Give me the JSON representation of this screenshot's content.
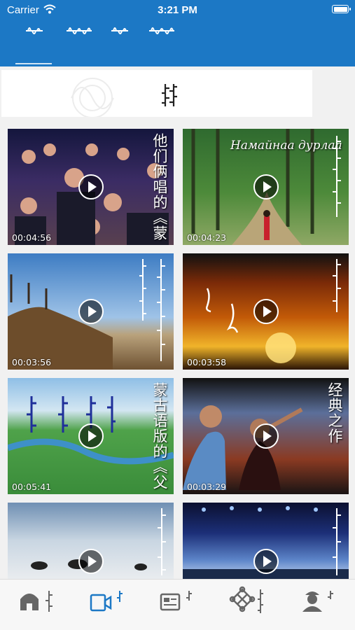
{
  "status_bar": {
    "carrier": "Carrier",
    "time": "3:21 PM"
  },
  "colors": {
    "header": "#1c78c5",
    "nav_active": "#1c78c5",
    "nav_inactive": "#666666"
  },
  "videos": [
    {
      "duration": "00:04:56",
      "caption": "他们俩唱的《蒙"
    },
    {
      "duration": "00:04:23",
      "caption": "Намайнаа дурлаа"
    },
    {
      "duration": "00:03:56",
      "caption": ""
    },
    {
      "duration": "00:03:58",
      "caption": ""
    },
    {
      "duration": "00:05:41",
      "caption": "蒙古语版的《父"
    },
    {
      "duration": "00:03:29",
      "caption": "经典之作"
    },
    {
      "duration": "",
      "caption": ""
    },
    {
      "duration": "",
      "caption": ""
    }
  ],
  "nav_icons": [
    "home-icon",
    "video-icon",
    "news-card-icon",
    "knot-icon",
    "user-icon"
  ]
}
